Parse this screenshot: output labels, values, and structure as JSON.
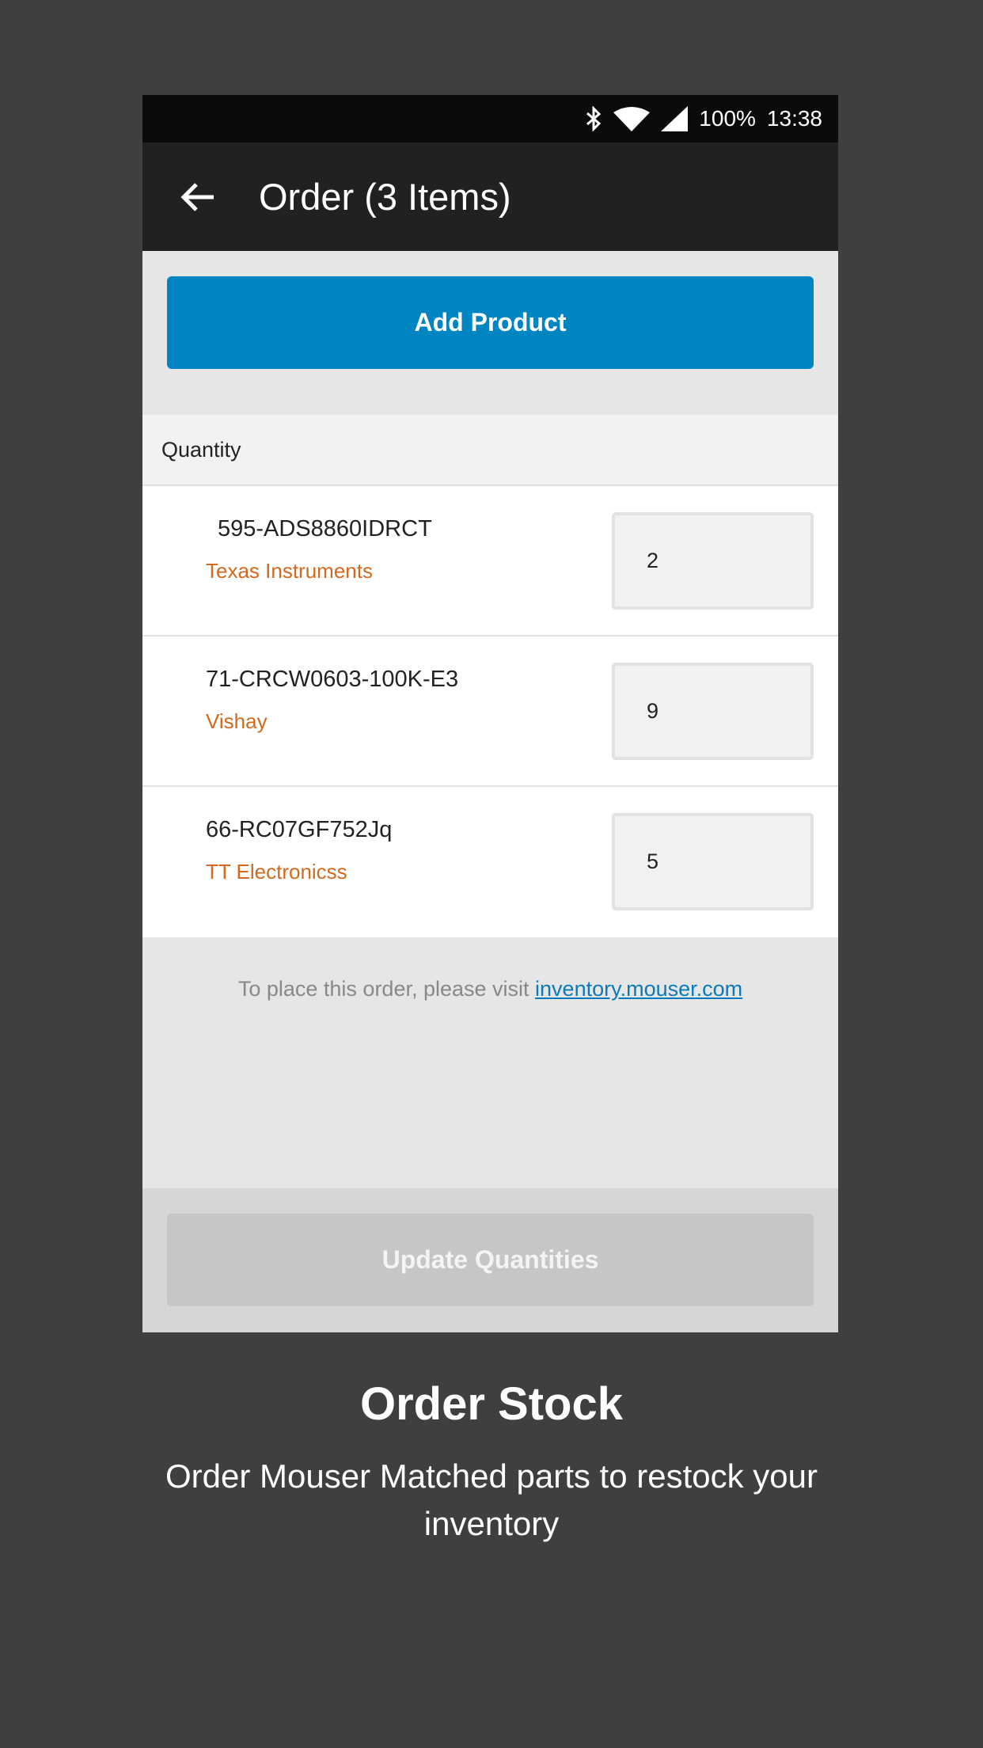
{
  "status_bar": {
    "battery": "100%",
    "time": "13:38",
    "icons": [
      "bluetooth-icon",
      "wifi-icon",
      "signal-icon"
    ]
  },
  "app_bar": {
    "title": "Order (3 Items)",
    "back_icon": "arrow-left-icon"
  },
  "add_product_label": "Add Product",
  "list_header": "Quantity",
  "items": [
    {
      "part": "595-ADS8860IDRCT",
      "manufacturer": "Texas Instruments",
      "quantity": "2"
    },
    {
      "part": "71-CRCW0603-100K-E3",
      "manufacturer": "Vishay",
      "quantity": "9"
    },
    {
      "part": "66-RC07GF752Jq",
      "manufacturer": "TT Electronicss",
      "quantity": "5"
    }
  ],
  "note": {
    "text": "To place this order, please visit ",
    "link": "inventory.mouser.com"
  },
  "update_label": "Update Quantities",
  "caption": {
    "title": "Order Stock",
    "subtitle": "Order Mouser Matched parts to restock your inventory"
  },
  "colors": {
    "accent": "#0085c3",
    "manufacturer": "#d2691e",
    "link": "#0a7ab8"
  }
}
